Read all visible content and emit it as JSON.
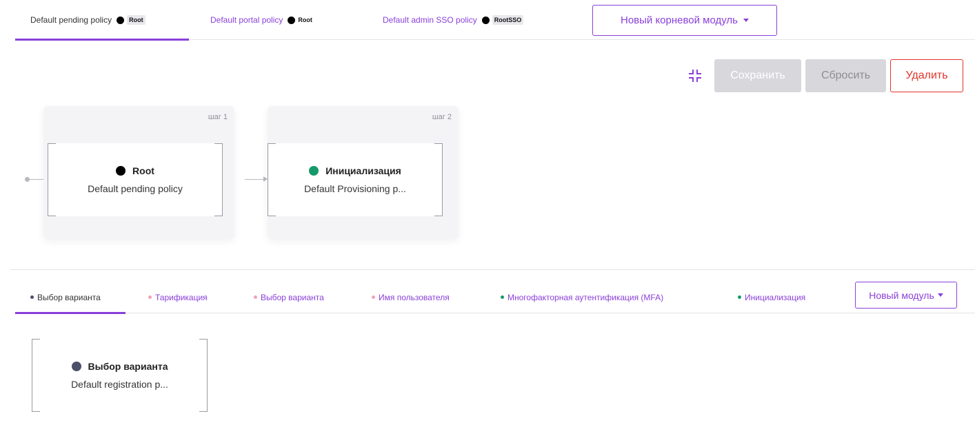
{
  "policy_tabs": [
    {
      "label": "Default pending policy",
      "badge": "Root",
      "active": true
    },
    {
      "label": "Default portal policy",
      "badge": "Root",
      "active": false
    },
    {
      "label": "Default admin SSO policy",
      "badge": "RootSSO",
      "active": false
    }
  ],
  "new_root_module": {
    "label": "Новый корневой модуль",
    "icon": "chevron-down-icon"
  },
  "toolbar": {
    "compress_icon": "compress-icon",
    "save_label": "Сохранить",
    "reset_label": "Сбросить",
    "delete_label": "Удалить"
  },
  "flow": {
    "steps": [
      {
        "step_label": "шаг 1",
        "title": "Root",
        "subtitle": "Default pending policy",
        "dot_color": "#000000"
      },
      {
        "step_label": "шаг 2",
        "title": "Инициализация",
        "subtitle": "Default Provisioning p...",
        "dot_color": "#16996b"
      }
    ]
  },
  "module_tabs": [
    {
      "label": "Выбор варианта",
      "dot_color": "#4a5068",
      "active": true
    },
    {
      "label": "Тарификация",
      "dot_color": "#f0a3b8",
      "active": false
    },
    {
      "label": "Выбор варианта",
      "dot_color": "#f0a3b8",
      "active": false
    },
    {
      "label": "Имя пользователя",
      "dot_color": "#f0a3b8",
      "active": false
    },
    {
      "label": "Многофакторная аутентификация (MFA)",
      "dot_color": "#16996b",
      "active": false
    },
    {
      "label": "Инициализация",
      "dot_color": "#16996b",
      "active": false
    }
  ],
  "new_module": {
    "label": "Новый модуль",
    "icon": "chevron-down-icon"
  },
  "module_node": {
    "title": "Выбор варианта",
    "subtitle": "Default registration p...",
    "dot_color": "#4a5068"
  },
  "colors": {
    "accent": "#8a3fd9",
    "danger": "#e0342a",
    "disabled": "#d8d8dc"
  }
}
